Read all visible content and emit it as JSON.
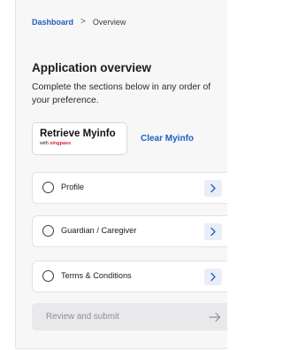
{
  "breadcrumb": {
    "root": "Dashboard",
    "separator": ">",
    "current": "Overview"
  },
  "page": {
    "title": "Application overview",
    "description": "Complete the sections below in any order of your preference."
  },
  "myinfo": {
    "title": "Retrieve Myinfo",
    "with_label": "with ",
    "brand": "singpass",
    "clear_label": "Clear Myinfo"
  },
  "sections": [
    {
      "label": "Profile",
      "icon": "chevron-right-icon"
    },
    {
      "label": "Guardian / Caregiver",
      "icon": "chevron-right-icon"
    },
    {
      "label": "Terms & Conditions",
      "icon": "chevron-right-icon"
    }
  ],
  "review": {
    "label": "Review and submit",
    "icon": "arrow-right-icon"
  },
  "colors": {
    "link": "#1f5fbf",
    "brand_red": "#e2202f",
    "chevron_bg": "#e9eef8",
    "disabled_bg": "#e9e9ec",
    "disabled_text": "#8f8f95"
  }
}
